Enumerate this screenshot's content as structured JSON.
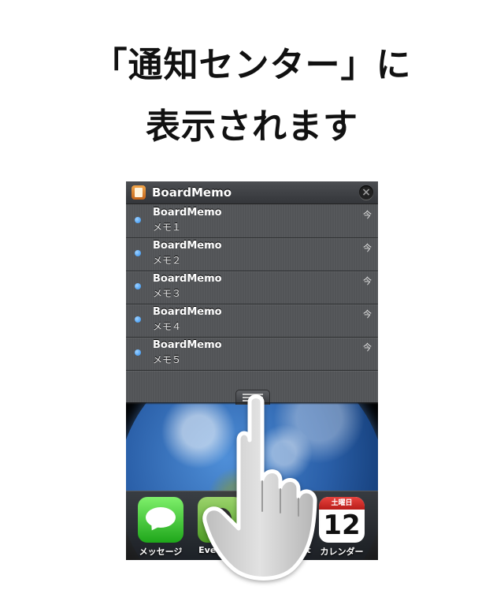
{
  "headline": {
    "line1": "「通知センター」に",
    "line2": "表示されます"
  },
  "notification_center": {
    "app_name": "BoardMemo",
    "close_icon": "close-icon",
    "app_icon": "boardmemo-app-icon",
    "notifications": [
      {
        "title": "BoardMemo",
        "body": "メモ１",
        "time": "今"
      },
      {
        "title": "BoardMemo",
        "body": "メモ２",
        "time": "今"
      },
      {
        "title": "BoardMemo",
        "body": "メモ３",
        "time": "今"
      },
      {
        "title": "BoardMemo",
        "body": "メモ４",
        "time": "今"
      },
      {
        "title": "BoardMemo",
        "body": "メモ５",
        "time": "今"
      }
    ]
  },
  "dock": {
    "apps": [
      {
        "label": "メッセージ",
        "icon": "messages-icon"
      },
      {
        "label": "Evernote",
        "icon": "evernote-icon"
      },
      {
        "label": "t",
        "icon": "hidden-app-icon"
      },
      {
        "label": "カレンダー",
        "icon": "calendar-icon",
        "weekday": "土曜日",
        "day": "12"
      }
    ]
  },
  "colors": {
    "shade": "#545659",
    "unread_dot": "#2d8ef0",
    "messages_green": "#1ea61a",
    "calendar_red": "#e8433e"
  }
}
